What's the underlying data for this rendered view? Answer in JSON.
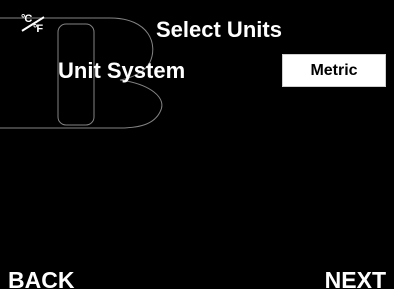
{
  "header": {
    "icon": "units-toggle-icon",
    "icon_text_top": "°C",
    "icon_text_bottom": "°F",
    "title": "Select Units"
  },
  "setting": {
    "label": "Unit System",
    "value": "Metric"
  },
  "footer": {
    "back_label": "BACK",
    "next_label": "NEXT"
  },
  "colors": {
    "background": "#000000",
    "text": "#ffffff",
    "button_background": "#ffffff",
    "button_text": "#000000"
  }
}
